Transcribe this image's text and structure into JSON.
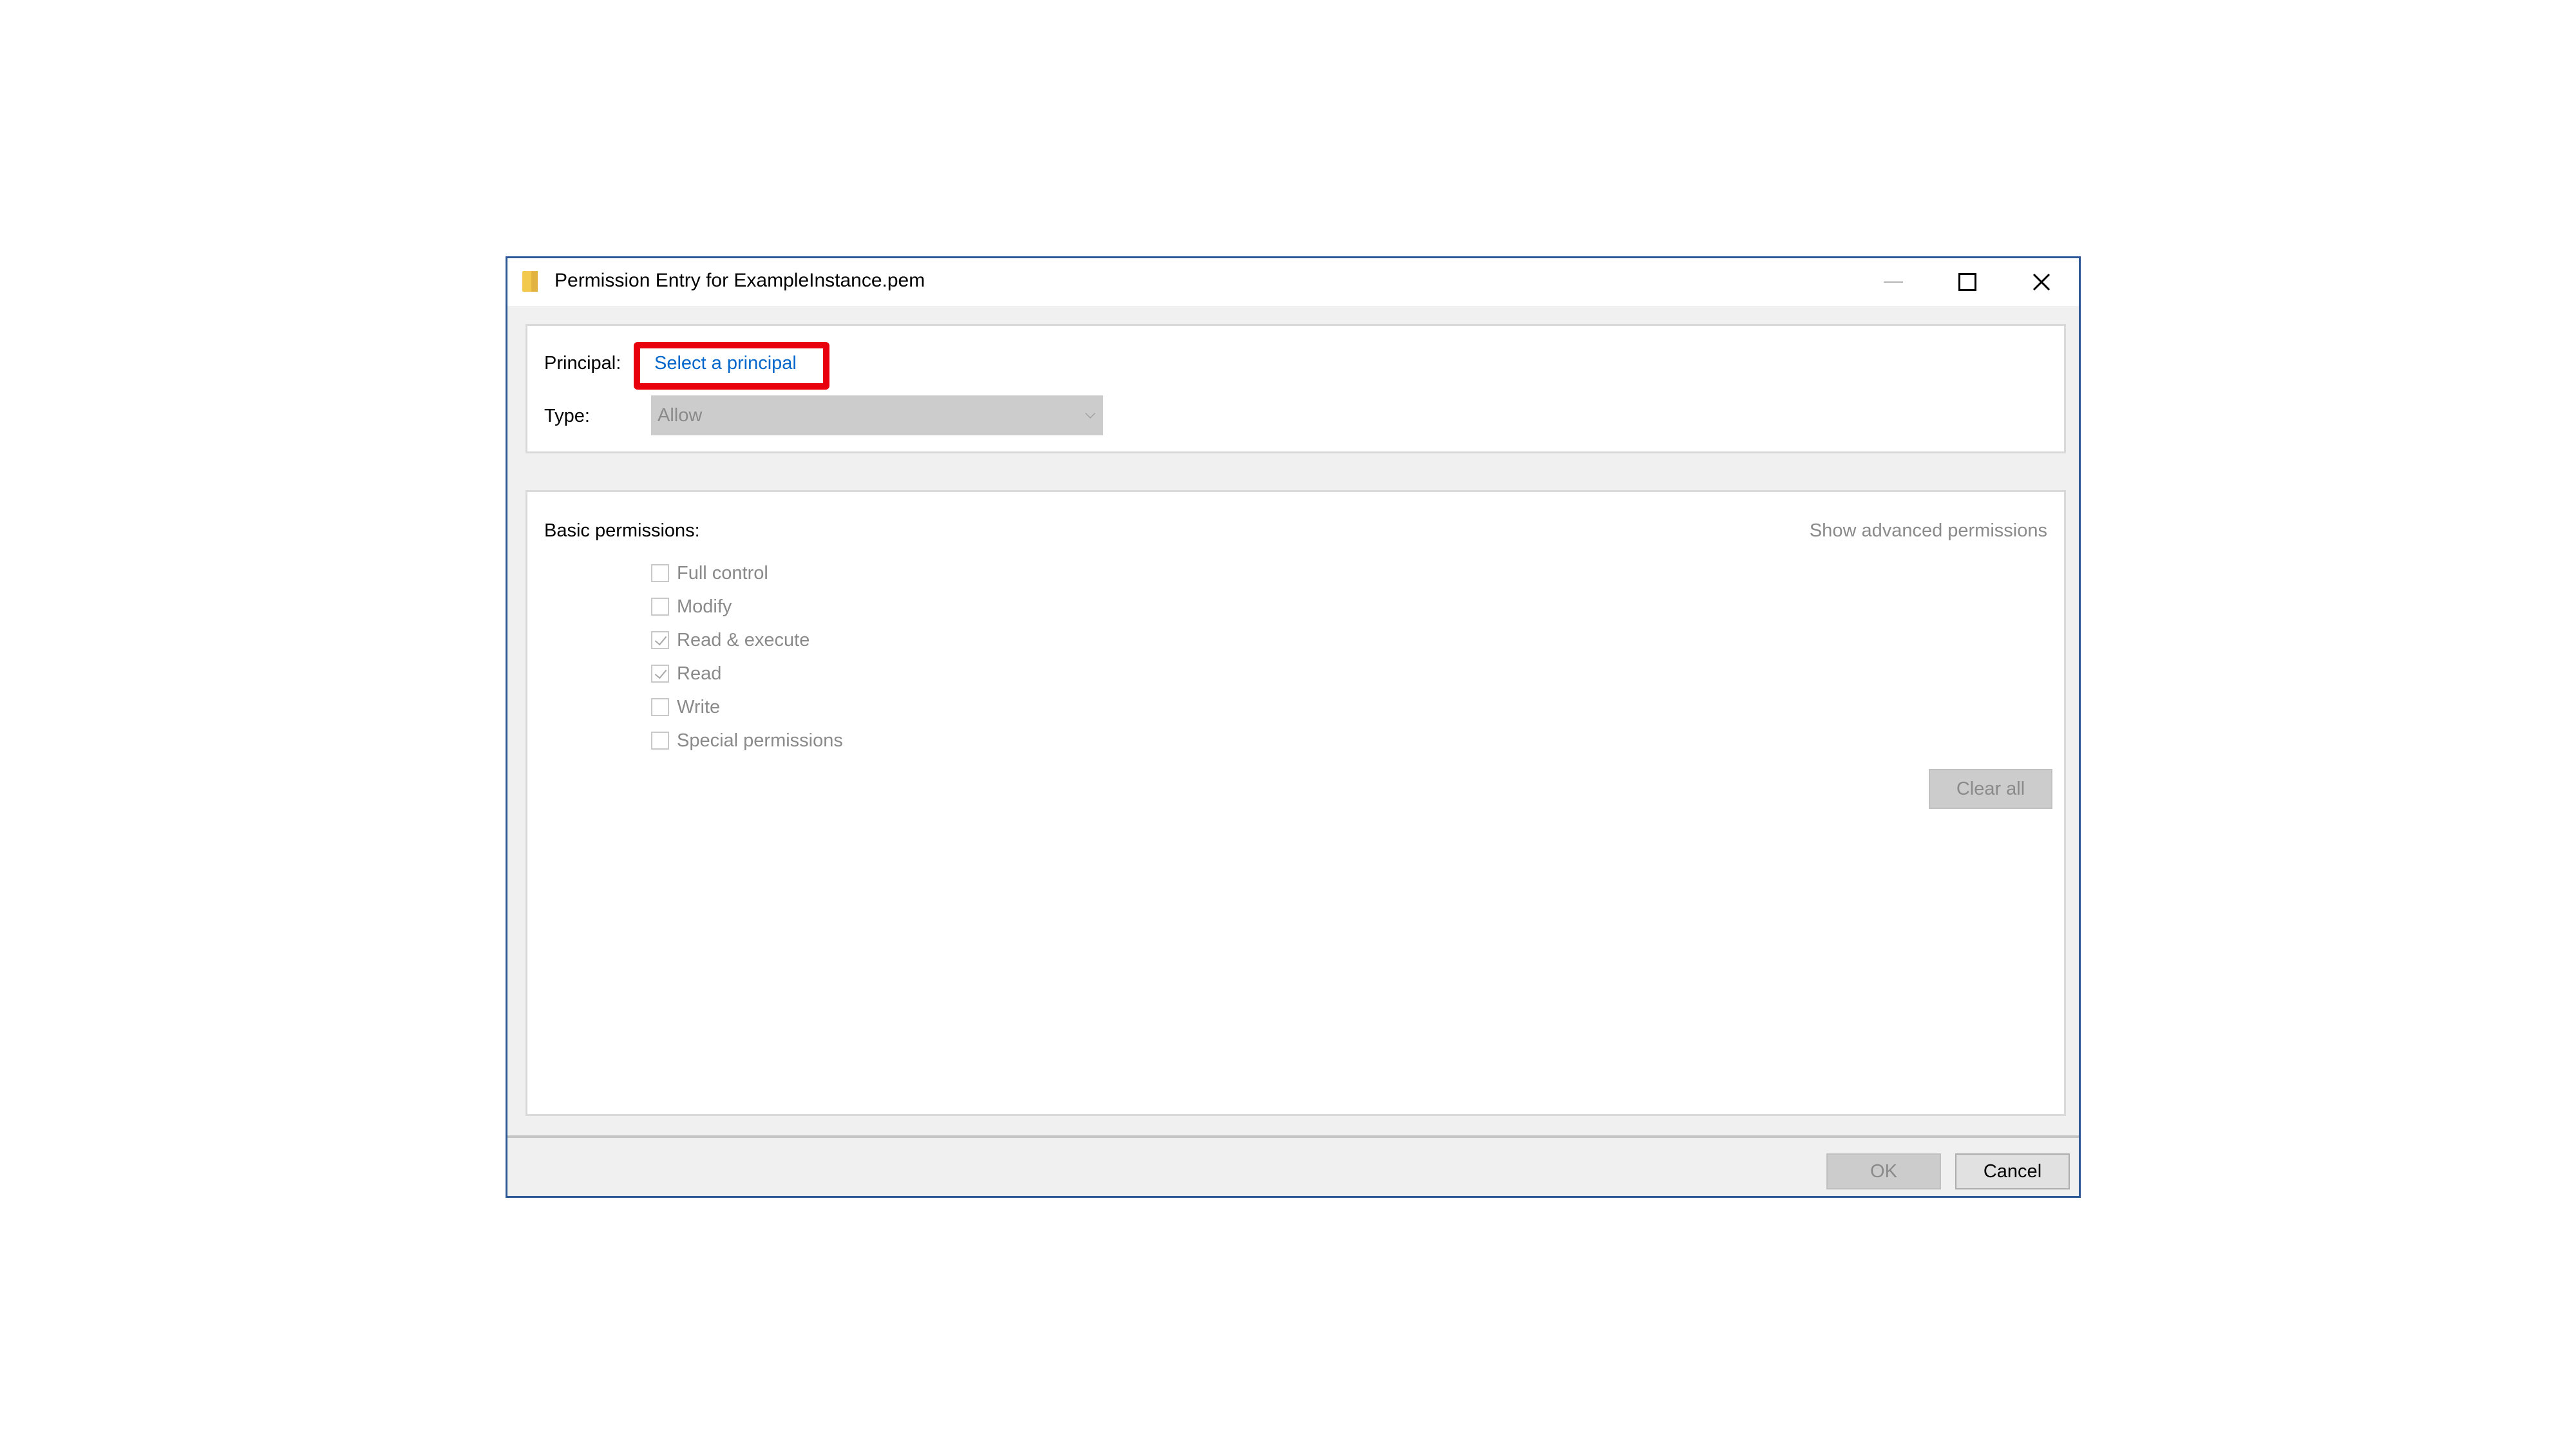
{
  "window": {
    "title": "Permission Entry for ExampleInstance.pem",
    "icon": "folder-icon",
    "accent_color": "#2b5797"
  },
  "principal": {
    "label": "Principal:",
    "link_text": "Select a principal",
    "highlight_color": "#e8000c"
  },
  "type": {
    "label": "Type:",
    "selected": "Allow"
  },
  "permissions": {
    "label": "Basic permissions:",
    "advanced_link": "Show advanced permissions",
    "items": [
      {
        "label": "Full control",
        "checked": false
      },
      {
        "label": "Modify",
        "checked": false
      },
      {
        "label": "Read & execute",
        "checked": true
      },
      {
        "label": "Read",
        "checked": true
      },
      {
        "label": "Write",
        "checked": false
      },
      {
        "label": "Special permissions",
        "checked": false
      }
    ],
    "clear_all": "Clear all"
  },
  "footer": {
    "ok": "OK",
    "cancel": "Cancel"
  }
}
